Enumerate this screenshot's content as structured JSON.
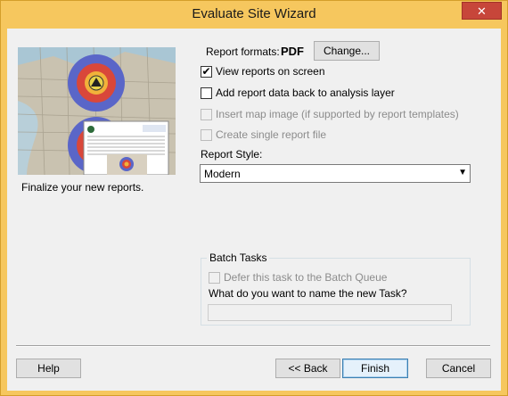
{
  "window": {
    "title": "Evaluate Site Wizard",
    "close_glyph": "✕"
  },
  "left_panel": {
    "image": "map-preview-illustration",
    "caption": "Finalize your new reports."
  },
  "report": {
    "formats_label": "Report formats:",
    "formats_value": "PDF",
    "change_button": "Change...",
    "view_on_screen": {
      "label": "View reports on screen",
      "checked": true,
      "enabled": true
    },
    "add_data_back": {
      "label": "Add report data back to analysis layer",
      "checked": false,
      "enabled": true
    },
    "insert_map_image": {
      "label": "Insert map image (if supported by report templates)",
      "checked": false,
      "enabled": false
    },
    "single_file": {
      "label": "Create single report file",
      "checked": false,
      "enabled": false
    },
    "style_label": "Report Style:",
    "style_value": "Modern"
  },
  "batch": {
    "group_title": "Batch Tasks",
    "defer_label": "Defer this task to the Batch Queue",
    "defer_checked": false,
    "name_prompt": "What do you want to name the new Task?",
    "name_value": ""
  },
  "footer": {
    "help": "Help",
    "back": "<< Back",
    "finish": "Finish",
    "cancel": "Cancel"
  },
  "colors": {
    "title_bar": "#f6c75e",
    "close_button": "#c7463a",
    "client_bg": "#f0f0f0"
  }
}
